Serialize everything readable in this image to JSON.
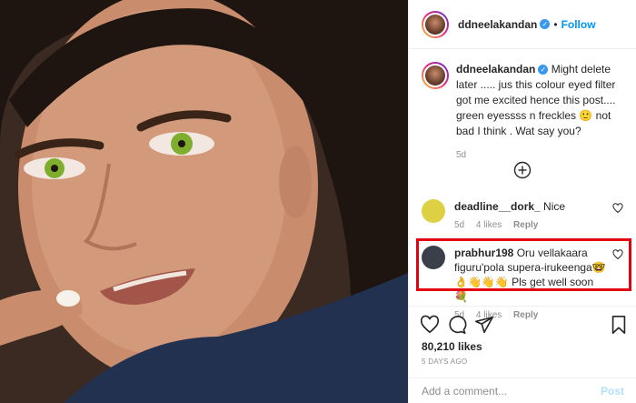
{
  "post": {
    "username": "ddneelakandan",
    "follow_label": "Follow",
    "dot": "•",
    "verified_glyph": "✓"
  },
  "caption": {
    "username": "ddneelakandan",
    "text": " Might delete later ..... jus this colour eyed filter got me excited hence this post.... green eyessss n freckles 🙂 not bad I think . Wat say you?",
    "time": "5d"
  },
  "comments": [
    {
      "username": "deadline__dork_",
      "text": " Nice",
      "time": "5d",
      "likes": "4 likes",
      "reply": "Reply",
      "avatar_color": "#ddd044"
    },
    {
      "username": "prabhur198",
      "text": " Oru vellakaara figuru'pola supera-irukeenga🤓👌👋👋👋 Pls get well soon 💐",
      "time": "5d",
      "likes": "4 likes",
      "reply": "Reply",
      "avatar_color": "#3a3f4a"
    }
  ],
  "actions": {
    "likes": "80,210 likes",
    "posted": "5 DAYS AGO"
  },
  "add_comment": {
    "placeholder": "Add a comment...",
    "post_label": "Post"
  },
  "colors": {
    "link": "#0095f6",
    "highlight": "#e3000f",
    "muted": "#8e8e8e"
  },
  "icons": [
    "heart-icon",
    "comment-icon",
    "share-icon",
    "bookmark-icon",
    "add-circle-icon",
    "verified-icon"
  ]
}
